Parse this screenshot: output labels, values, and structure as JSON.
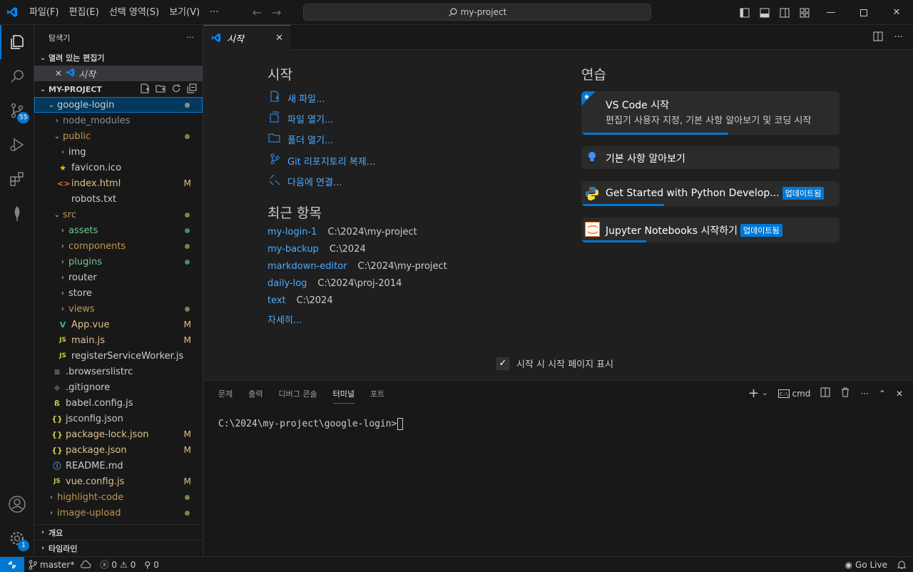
{
  "titlebar": {
    "menu": [
      "파일(F)",
      "편집(E)",
      "선택 영역(S)",
      "보기(V)",
      "···"
    ],
    "search_text": "my-project",
    "accent": "#0078d4"
  },
  "activity": {
    "scm_badge": "55",
    "settings_badge": "1"
  },
  "explorer": {
    "title": "탐색기",
    "more": "···",
    "open_editors_label": "열려 있는 편집기",
    "open_editor_item": "시작",
    "project_label": "MY-PROJECT",
    "tree": [
      {
        "label": "google-login",
        "color": "#cccccc"
      },
      {
        "label": "node_modules",
        "color": "#8c8c8c"
      },
      {
        "label": "public",
        "color": "#c09553"
      },
      {
        "label": "img",
        "color": "#cccccc"
      },
      {
        "label": "favicon.ico",
        "color": "#cccccc"
      },
      {
        "label": "index.html",
        "color": "#e2c08d",
        "status": "M"
      },
      {
        "label": "robots.txt",
        "color": "#cccccc"
      },
      {
        "label": "src",
        "color": "#c09553"
      },
      {
        "label": "assets",
        "color": "#73c991"
      },
      {
        "label": "components",
        "color": "#c09553"
      },
      {
        "label": "plugins",
        "color": "#73c991"
      },
      {
        "label": "router",
        "color": "#cccccc"
      },
      {
        "label": "store",
        "color": "#cccccc"
      },
      {
        "label": "views",
        "color": "#c09553"
      },
      {
        "label": "App.vue",
        "color": "#e2c08d",
        "status": "M"
      },
      {
        "label": "main.js",
        "color": "#e2c08d",
        "status": "M"
      },
      {
        "label": "registerServiceWorker.js",
        "color": "#cccccc"
      },
      {
        "label": ".browserslistrc",
        "color": "#cccccc"
      },
      {
        "label": ".gitignore",
        "color": "#cccccc"
      },
      {
        "label": "babel.config.js",
        "color": "#cccccc"
      },
      {
        "label": "jsconfig.json",
        "color": "#cccccc"
      },
      {
        "label": "package-lock.json",
        "color": "#e2c08d",
        "status": "M"
      },
      {
        "label": "package.json",
        "color": "#e2c08d",
        "status": "M"
      },
      {
        "label": "README.md",
        "color": "#cccccc"
      },
      {
        "label": "vue.config.js",
        "color": "#e2c08d",
        "status": "M"
      },
      {
        "label": "highlight-code",
        "color": "#c09553"
      },
      {
        "label": "image-upload",
        "color": "#c09553"
      }
    ],
    "outline_label": "개요",
    "timeline_label": "타임라인"
  },
  "editor": {
    "tab_label": "시작",
    "start_heading": "시작",
    "start_items": [
      "새 파일...",
      "파일 열기...",
      "폴더 열기...",
      "Git 리포지토리 복제...",
      "다음에 연결..."
    ],
    "recent_heading": "최근 항목",
    "recent": [
      {
        "name": "my-login-1",
        "path": "C:\\2024\\my-project"
      },
      {
        "name": "my-backup",
        "path": "C:\\2024"
      },
      {
        "name": "markdown-editor",
        "path": "C:\\2024\\my-project"
      },
      {
        "name": "daily-log",
        "path": "C:\\2024\\proj-2014"
      },
      {
        "name": "text",
        "path": "C:\\2024"
      }
    ],
    "more_label": "자세히...",
    "walkthroughs_heading": "연습",
    "walkthroughs": {
      "vscode_title": "VS Code 시작",
      "vscode_desc": "편집기 사용자 지정, 기본 사항 알아보기 및 코딩 시작",
      "vscode_progress": 0.57,
      "basics_title": "기본 사항 알아보기",
      "python_title": "Get Started with Python Develop...",
      "python_progress": 0.32,
      "jupyter_title": "Jupyter Notebooks 시작하기",
      "jupyter_progress": 0.25,
      "updated_badge": "업데이트됨"
    },
    "show_on_startup": "시작 시 시작 페이지 표시"
  },
  "panel": {
    "tabs": [
      "문제",
      "출력",
      "디버그 콘솔",
      "터미널",
      "포트"
    ],
    "active_tab": "터미널",
    "shell_label": "cmd",
    "prompt": "C:\\2024\\my-project\\google-login>"
  },
  "statusbar": {
    "branch": "master*",
    "errors": "0",
    "warnings": "0",
    "ports": "0",
    "golive": "Go Live"
  }
}
